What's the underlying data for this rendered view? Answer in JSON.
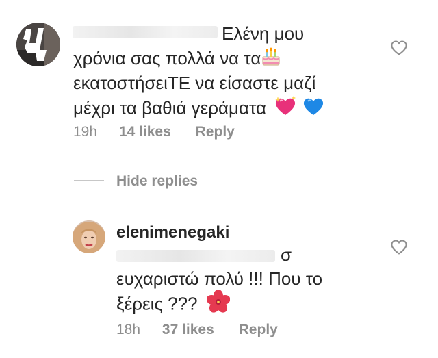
{
  "comment": {
    "text_line1": "Ελένη μου",
    "text_line2": "χρόνια σας πολλά να τα",
    "text_line3": "εκατοστήσειΤΕ να είσαστε μαζί",
    "text_line4": "μέχρι τα βαθιά γεράματα",
    "time": "19h",
    "likes": "14 likes",
    "reply": "Reply",
    "emojis": [
      "birthday-cake",
      "sparkling-heart",
      "blue-heart"
    ]
  },
  "hide_replies": "Hide replies",
  "reply_comment": {
    "username": "elenimenegaki",
    "text_line1": "σ",
    "text_line2": "ευχαριστώ πολύ !!! Που το",
    "text_line3": "ξέρεις ???",
    "time": "18h",
    "likes": "37 likes",
    "reply": "Reply",
    "emojis": [
      "hibiscus"
    ]
  },
  "colors": {
    "text": "#262626",
    "meta": "#8e8e8e",
    "heart_outline": "#8e8e8e",
    "blue_heart": "#1e88e5",
    "sparkle_heart": "#e8317a"
  }
}
